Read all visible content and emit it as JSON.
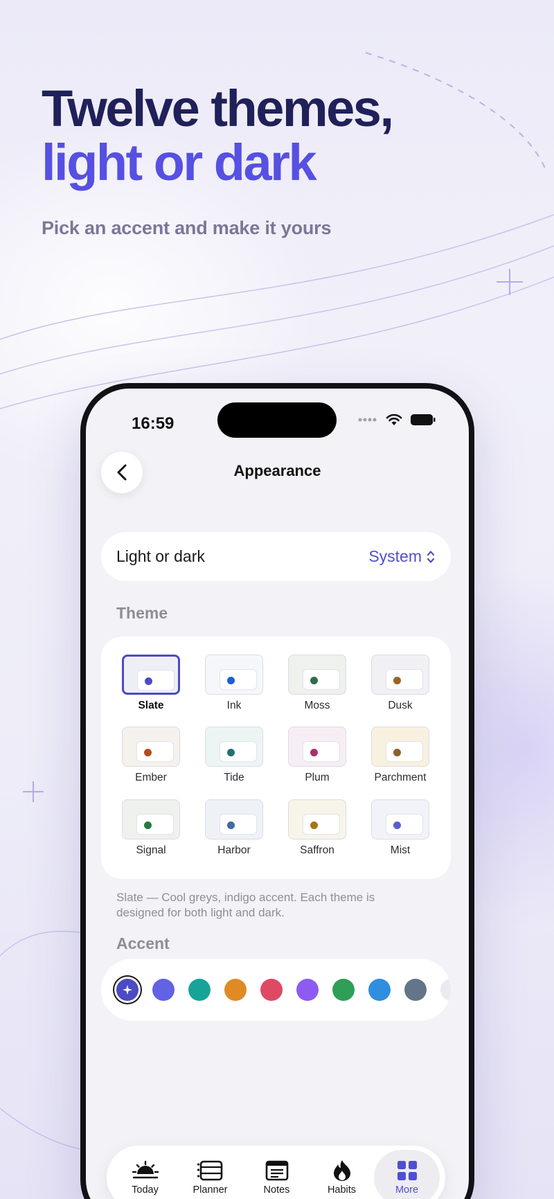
{
  "hero": {
    "title_line1": "Twelve themes,",
    "title_line2": "light or dark",
    "subtitle": "Pick an accent and make it yours"
  },
  "status_bar": {
    "time": "16:59"
  },
  "nav": {
    "title": "Appearance"
  },
  "appearance_mode": {
    "label": "Light or dark",
    "value": "System"
  },
  "theme_section": {
    "label": "Theme",
    "selected": "Slate",
    "themes": [
      {
        "name": "Slate",
        "bg": "#eeeef7",
        "dot": "#4b4bc4"
      },
      {
        "name": "Ink",
        "bg": "#f6f7fb",
        "dot": "#1c5fd6"
      },
      {
        "name": "Moss",
        "bg": "#eef1ec",
        "dot": "#2f6b4d"
      },
      {
        "name": "Dusk",
        "bg": "#f1f0f5",
        "dot": "#9a6423"
      },
      {
        "name": "Ember",
        "bg": "#f5f1ed",
        "dot": "#b54a1f"
      },
      {
        "name": "Tide",
        "bg": "#edf4f4",
        "dot": "#1f7272"
      },
      {
        "name": "Plum",
        "bg": "#f7eef4",
        "dot": "#a73166"
      },
      {
        "name": "Parchment",
        "bg": "#f8f1df",
        "dot": "#8f5f28"
      },
      {
        "name": "Signal",
        "bg": "#eef1ee",
        "dot": "#237a3f"
      },
      {
        "name": "Harbor",
        "bg": "#eef2f7",
        "dot": "#3e6ba3"
      },
      {
        "name": "Saffron",
        "bg": "#f7f4ea",
        "dot": "#a87416"
      },
      {
        "name": "Mist",
        "bg": "#f1f3f9",
        "dot": "#5a5fd0"
      }
    ],
    "description": "Slate — Cool greys, indigo accent. Each theme is designed for both light and dark."
  },
  "accent_section": {
    "label": "Accent",
    "colors": [
      "#4b4bc4",
      "#6262e5",
      "#17a398",
      "#e08a24",
      "#de4a63",
      "#8d5bf2",
      "#2f9e57",
      "#2f8ee0",
      "#647489",
      "#eaeaf0"
    ]
  },
  "tabs": [
    {
      "label": "Today",
      "icon": "sunrise-icon"
    },
    {
      "label": "Planner",
      "icon": "planner-icon"
    },
    {
      "label": "Notes",
      "icon": "notes-icon"
    },
    {
      "label": "Habits",
      "icon": "flame-icon"
    },
    {
      "label": "More",
      "icon": "grid-icon",
      "active": true
    }
  ]
}
